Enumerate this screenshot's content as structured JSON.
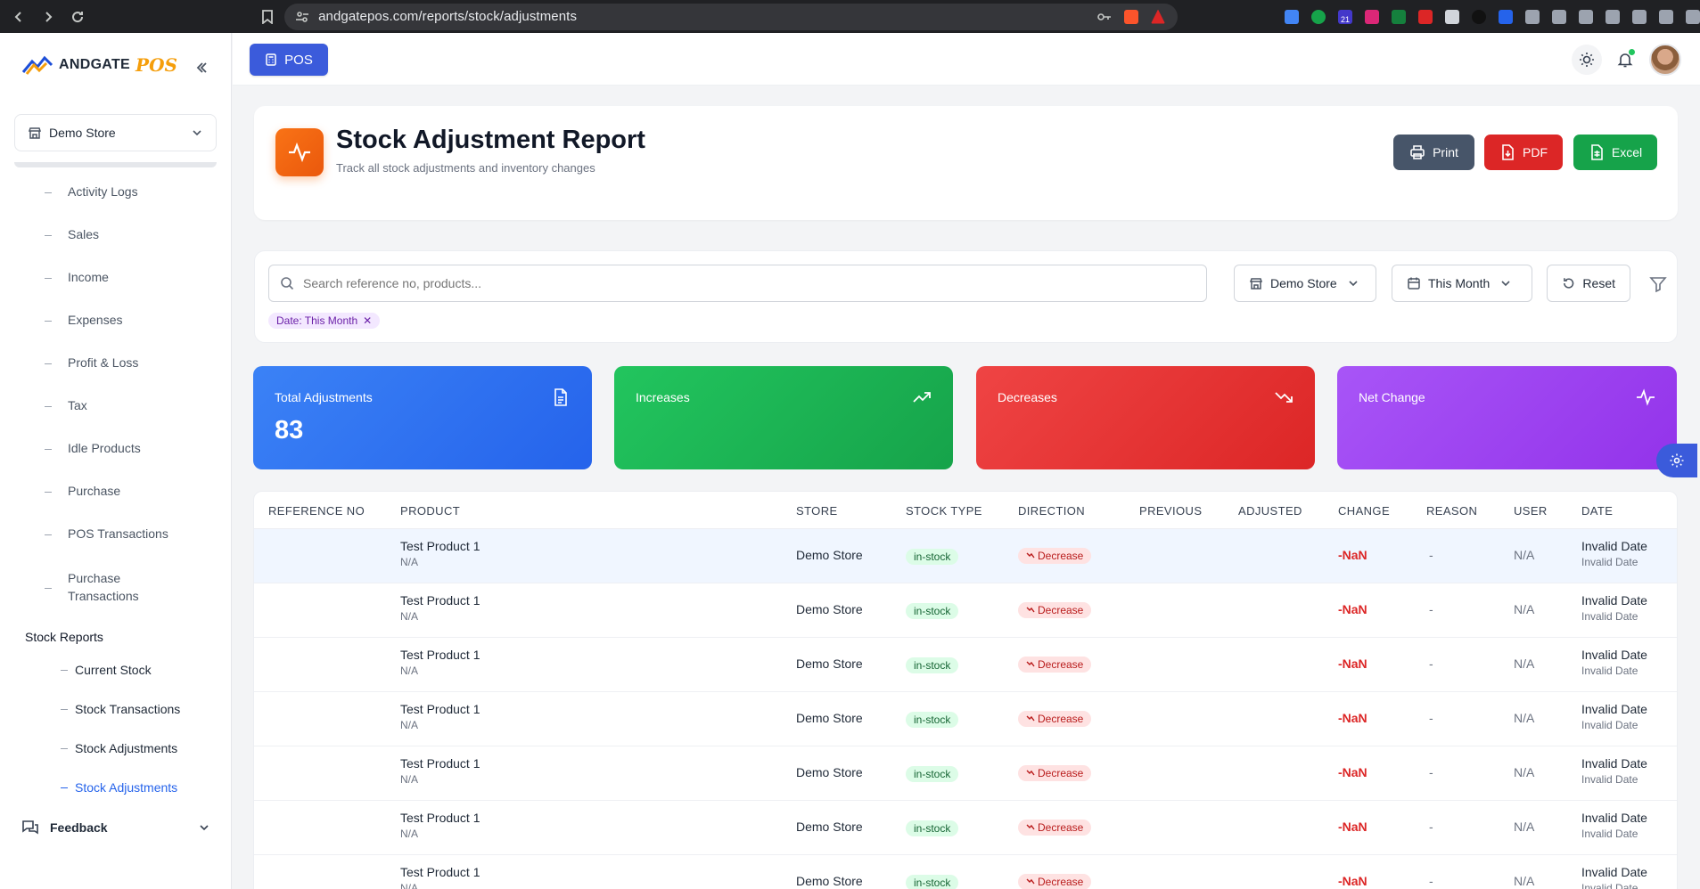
{
  "browser": {
    "url": "andgatepos.com/reports/stock/adjustments",
    "extension_badge": "21"
  },
  "sidebar": {
    "logo_text": "ANDGATE",
    "logo_accent": "POS",
    "store_select": "Demo Store",
    "menu_items": [
      {
        "label": "Activity Logs"
      },
      {
        "label": "Sales"
      },
      {
        "label": "Income"
      },
      {
        "label": "Expenses"
      },
      {
        "label": "Profit & Loss"
      },
      {
        "label": "Tax"
      },
      {
        "label": "Idle Products"
      },
      {
        "label": "Purchase"
      },
      {
        "label": "POS Transactions"
      },
      {
        "label": "Purchase\nTransactions"
      }
    ],
    "section_stock": "Stock Reports",
    "stock_items": [
      {
        "label": "Current Stock"
      },
      {
        "label": "Stock Transactions"
      },
      {
        "label": "Stock Adjustments"
      },
      {
        "label": "Stock Adjustments",
        "active": true
      }
    ],
    "feedback": "Feedback"
  },
  "topbar": {
    "pos_label": "POS"
  },
  "header": {
    "title": "Stock Adjustment Report",
    "subtitle": "Track all stock adjustments and inventory changes",
    "print_label": "Print",
    "pdf_label": "PDF",
    "excel_label": "Excel"
  },
  "filters": {
    "search_placeholder": "Search reference no, products...",
    "store": "Demo Store",
    "date_range": "This Month",
    "reset_label": "Reset",
    "chip": "Date: This Month"
  },
  "stats": {
    "total_label": "Total Adjustments",
    "total_value": "83",
    "increases_label": "Increases",
    "decreases_label": "Decreases",
    "net_label": "Net Change"
  },
  "table": {
    "columns": [
      "REFERENCE NO",
      "PRODUCT",
      "STORE",
      "STOCK TYPE",
      "DIRECTION",
      "PREVIOUS",
      "ADJUSTED",
      "CHANGE",
      "REASON",
      "USER",
      "DATE"
    ],
    "rows": [
      {
        "product": "Test Product 1",
        "product_sub": "N/A",
        "store": "Demo Store",
        "type": "in-stock",
        "direction": "Decrease",
        "change": "-NaN",
        "reason": "-",
        "user": "N/A",
        "date": "Invalid Date",
        "date_sub": "Invalid Date"
      },
      {
        "product": "Test Product 1",
        "product_sub": "N/A",
        "store": "Demo Store",
        "type": "in-stock",
        "direction": "Decrease",
        "change": "-NaN",
        "reason": "-",
        "user": "N/A",
        "date": "Invalid Date",
        "date_sub": "Invalid Date"
      },
      {
        "product": "Test Product 1",
        "product_sub": "N/A",
        "store": "Demo Store",
        "type": "in-stock",
        "direction": "Decrease",
        "change": "-NaN",
        "reason": "-",
        "user": "N/A",
        "date": "Invalid Date",
        "date_sub": "Invalid Date"
      },
      {
        "product": "Test Product 1",
        "product_sub": "N/A",
        "store": "Demo Store",
        "type": "in-stock",
        "direction": "Decrease",
        "change": "-NaN",
        "reason": "-",
        "user": "N/A",
        "date": "Invalid Date",
        "date_sub": "Invalid Date"
      },
      {
        "product": "Test Product 1",
        "product_sub": "N/A",
        "store": "Demo Store",
        "type": "in-stock",
        "direction": "Decrease",
        "change": "-NaN",
        "reason": "-",
        "user": "N/A",
        "date": "Invalid Date",
        "date_sub": "Invalid Date"
      },
      {
        "product": "Test Product 1",
        "product_sub": "N/A",
        "store": "Demo Store",
        "type": "in-stock",
        "direction": "Decrease",
        "change": "-NaN",
        "reason": "-",
        "user": "N/A",
        "date": "Invalid Date",
        "date_sub": "Invalid Date"
      },
      {
        "product": "Test Product 1",
        "product_sub": "N/A",
        "store": "Demo Store",
        "type": "in-stock",
        "direction": "Decrease",
        "change": "-NaN",
        "reason": "-",
        "user": "N/A",
        "date": "Invalid Date",
        "date_sub": "Invalid Date"
      }
    ]
  },
  "colors": {
    "accent": "#3b5bdb",
    "increase": "#16a34a",
    "decrease": "#dc2626",
    "net": "#9333ea",
    "total": "#2563eb"
  }
}
